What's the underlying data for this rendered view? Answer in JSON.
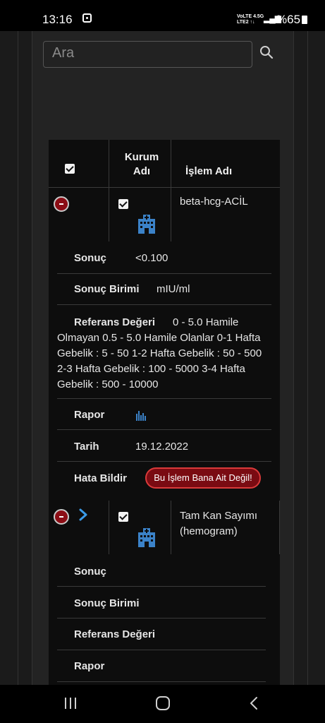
{
  "status_bar": {
    "time": "13:16",
    "network_top": "VoLTE 4.5G",
    "network_bottom": "LTE2 ↑↓",
    "battery": "%65"
  },
  "search": {
    "placeholder": "Ara"
  },
  "table": {
    "headers": {
      "kurum_adi": "Kurum Adı",
      "islem_adi": "İşlem Adı"
    },
    "rows": [
      {
        "name": "beta-hcg-ACİL",
        "details": {
          "sonuc_label": "Sonuç",
          "sonuc_value": "<0.100",
          "birim_label": "Sonuç Birimi",
          "birim_value": "mIU/ml",
          "referans_label": "Referans Değeri",
          "referans_value": "0 - 5.0 Hamile Olmayan 0.5 - 5.0 Hamile Olanlar 0-1 Hafta Gebelik : 5 - 50 1-2 Hafta Gebelik : 50 - 500 2-3 Hafta Gebelik : 100 - 5000 3-4 Hafta Gebelik : 500 - 10000",
          "rapor_label": "Rapor",
          "tarih_label": "Tarih",
          "tarih_value": "19.12.2022",
          "hata_label": "Hata Bildir",
          "hata_button": "Bu İşlem Bana Ait Değil!"
        }
      },
      {
        "name": "Tam Kan Sayımı (hemogram)",
        "details": {
          "sonuc_label": "Sonuç",
          "birim_label": "Sonuç Birimi",
          "referans_label": "Referans Değeri",
          "rapor_label": "Rapor"
        }
      }
    ]
  },
  "icons": {
    "search": "search-icon",
    "institution": "hospital-building-icon",
    "report": "bar-chart-icon"
  }
}
